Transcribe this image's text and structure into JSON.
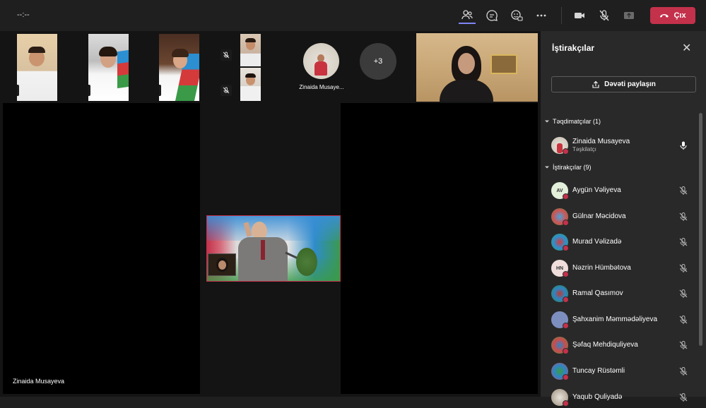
{
  "header": {
    "timer": "--:--",
    "leave_label": "Çıx"
  },
  "gallery": {
    "named_tile_label": "Zinaida Musaye...",
    "more_count": "+3"
  },
  "stage": {
    "tile_name": "Zinaida Musayeva"
  },
  "panel": {
    "title": "İştirakçılar",
    "invite_label": "Dəvəti paylaşın",
    "presenters_header": "Təqdimatçılar (1)",
    "attendees_header": "İştirakçılar (9)",
    "presenters": [
      {
        "name": "Zinaida Musayeva",
        "role": "Təşkilatçı"
      }
    ],
    "attendees": [
      {
        "name": "Aygün Vəliyeva",
        "initials": "AV"
      },
      {
        "name": "Gülnar Məcidova",
        "initials": ""
      },
      {
        "name": "Murad Vəlizadə",
        "initials": ""
      },
      {
        "name": "Nəzrin Hümbətova",
        "initials": "HN"
      },
      {
        "name": "Ramal Qasımov",
        "initials": ""
      },
      {
        "name": "Şahxanim Məmmədəliyeva",
        "initials": ""
      },
      {
        "name": "Şəfaq Mehdiquliyeva",
        "initials": ""
      },
      {
        "name": "Tuncay Rüstəmli",
        "initials": ""
      },
      {
        "name": "Yaqub Quliyadə",
        "initials": ""
      }
    ]
  },
  "colors": {
    "leave": "#c4314b",
    "accent": "#7f85f5",
    "panel_bg": "#292929"
  }
}
